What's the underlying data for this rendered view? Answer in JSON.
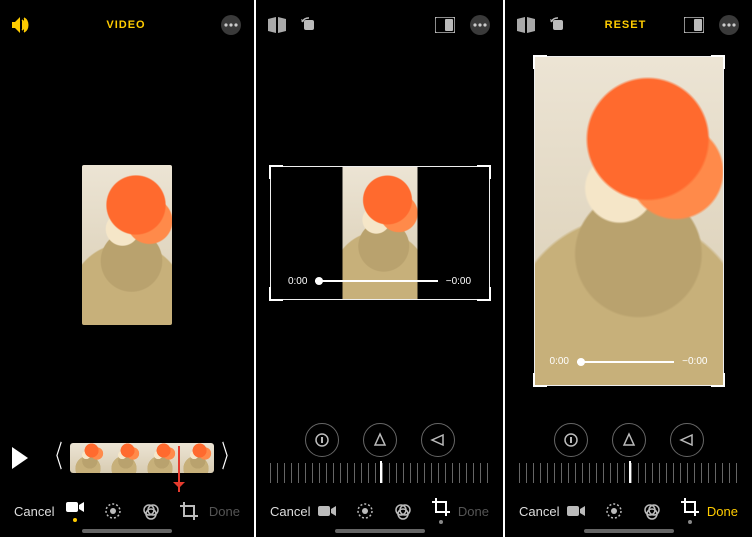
{
  "panel1": {
    "mode_label": "VIDEO",
    "cancel": "Cancel",
    "done": "Done"
  },
  "panel2": {
    "time_start": "0:00",
    "time_end": "−0:00",
    "cancel": "Cancel",
    "done": "Done"
  },
  "panel3": {
    "reset": "RESET",
    "time_start": "0:00",
    "time_end": "−0:00",
    "cancel": "Cancel",
    "done": "Done"
  }
}
